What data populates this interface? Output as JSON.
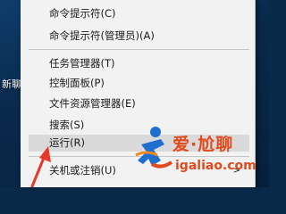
{
  "desktop": {
    "icon_label": "新聊"
  },
  "menu": {
    "items": [
      {
        "label": "命令提示符(C)",
        "highlighted": false
      },
      {
        "label": "命令提示符(管理员)(A)",
        "highlighted": false
      },
      {
        "label": "任务管理器(T)",
        "highlighted": false
      },
      {
        "label": "控制面板(P)",
        "highlighted": false
      },
      {
        "label": "文件资源管理器(E)",
        "highlighted": false
      },
      {
        "label": "搜索(S)",
        "highlighted": false
      },
      {
        "label": "运行(R)",
        "highlighted": true
      },
      {
        "label": "关机或注销(U)",
        "highlighted": false,
        "has_submenu": true
      }
    ],
    "submenu_arrow": ">"
  },
  "watermark": {
    "title": "爱·尬聊",
    "url": "igaliao.com",
    "colors": {
      "brand": "#e04a1d",
      "figure": "#1e6fd0"
    }
  },
  "annotation": {
    "color": "#e53a2a"
  }
}
